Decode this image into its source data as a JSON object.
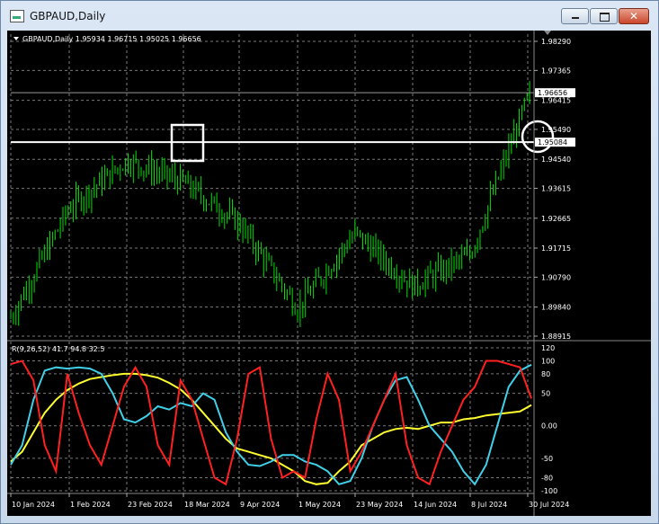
{
  "window": {
    "title": "GBPAUD,Daily",
    "buttons": {
      "minimize": "minimize",
      "maximize": "maximize",
      "close": "close"
    }
  },
  "header": {
    "info": "GBPAUD,Daily  1.95934 1.96715 1.95025 1.96656"
  },
  "price_panel": {
    "price_labels": [
      "1.98290",
      "1.97365",
      "1.96415",
      "1.95490",
      "1.94540",
      "1.93615",
      "1.92665",
      "1.91715",
      "1.90790",
      "1.89840",
      "1.88915"
    ],
    "current_price": "1.96656",
    "hline_price": "1.95084",
    "colors": {
      "candles": "#00e000",
      "hline": "#ffffff",
      "grid": "#7a7a7a",
      "background": "#000000",
      "current_price_line": "#9a9a9a"
    }
  },
  "indicator_panel": {
    "label": "R(9,26,52) 41.7 94.8 32.5",
    "levels": [
      "120",
      "100",
      "80",
      "50",
      "0.00",
      "-50",
      "-80",
      "-100"
    ],
    "colors": {
      "red": "#ff2020",
      "cyan": "#40d0e8",
      "yellow": "#ffff30"
    }
  },
  "date_labels": [
    "10 Jan 2024",
    "1 Feb 2024",
    "23 Feb 2024",
    "18 Mar 2024",
    "9 Apr 2024",
    "1 May 2024",
    "23 May 2024",
    "14 Jun 2024",
    "8 Jul 2024",
    "30 Jul 2024"
  ],
  "chart_data": {
    "type": "candlestick",
    "symbol": "GBPAUD",
    "timeframe": "Daily",
    "ohlc_last": {
      "open": 1.95934,
      "high": 1.96715,
      "low": 1.95025,
      "close": 1.96656
    },
    "y_range": [
      1.88915,
      1.9829
    ],
    "horizontal_line": 1.95084,
    "close_trend": [
      {
        "date": "10 Jan 2024",
        "close": 1.895
      },
      {
        "date": "1 Feb 2024",
        "close": 1.93
      },
      {
        "date": "23 Feb 2024",
        "close": 1.945
      },
      {
        "date": "18 Mar 2024",
        "close": 1.938
      },
      {
        "date": "9 Apr 2024",
        "close": 1.925
      },
      {
        "date": "1 May 2024",
        "close": 1.898
      },
      {
        "date": "23 May 2024",
        "close": 1.922
      },
      {
        "date": "14 Jun 2024",
        "close": 1.905
      },
      {
        "date": "8 Jul 2024",
        "close": 1.915
      },
      {
        "date": "30 Jul 2024",
        "close": 1.965
      }
    ],
    "oscillator": {
      "name": "R(9,26,52)",
      "values": [
        41.7,
        94.8,
        32.5
      ],
      "range": [
        -100,
        120
      ]
    }
  }
}
